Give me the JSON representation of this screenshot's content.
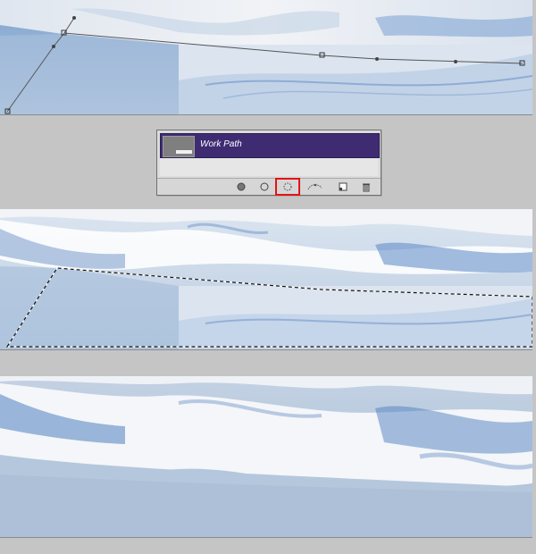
{
  "paths_palette": {
    "path_name": "Work Path",
    "footer_buttons": [
      {
        "name": "fill-path-icon"
      },
      {
        "name": "stroke-path-icon"
      },
      {
        "name": "load-path-as-selection-icon",
        "highlighted": true
      },
      {
        "name": "make-work-path-icon"
      },
      {
        "name": "new-path-icon"
      },
      {
        "name": "delete-path-icon"
      }
    ],
    "highlight_color": "#e01515"
  },
  "colors": {
    "background": "#c5c5c5",
    "snow_light": "#e8edf3",
    "snow_blue": "#4f7fc0",
    "sky_flat": "#b6c8dd"
  }
}
